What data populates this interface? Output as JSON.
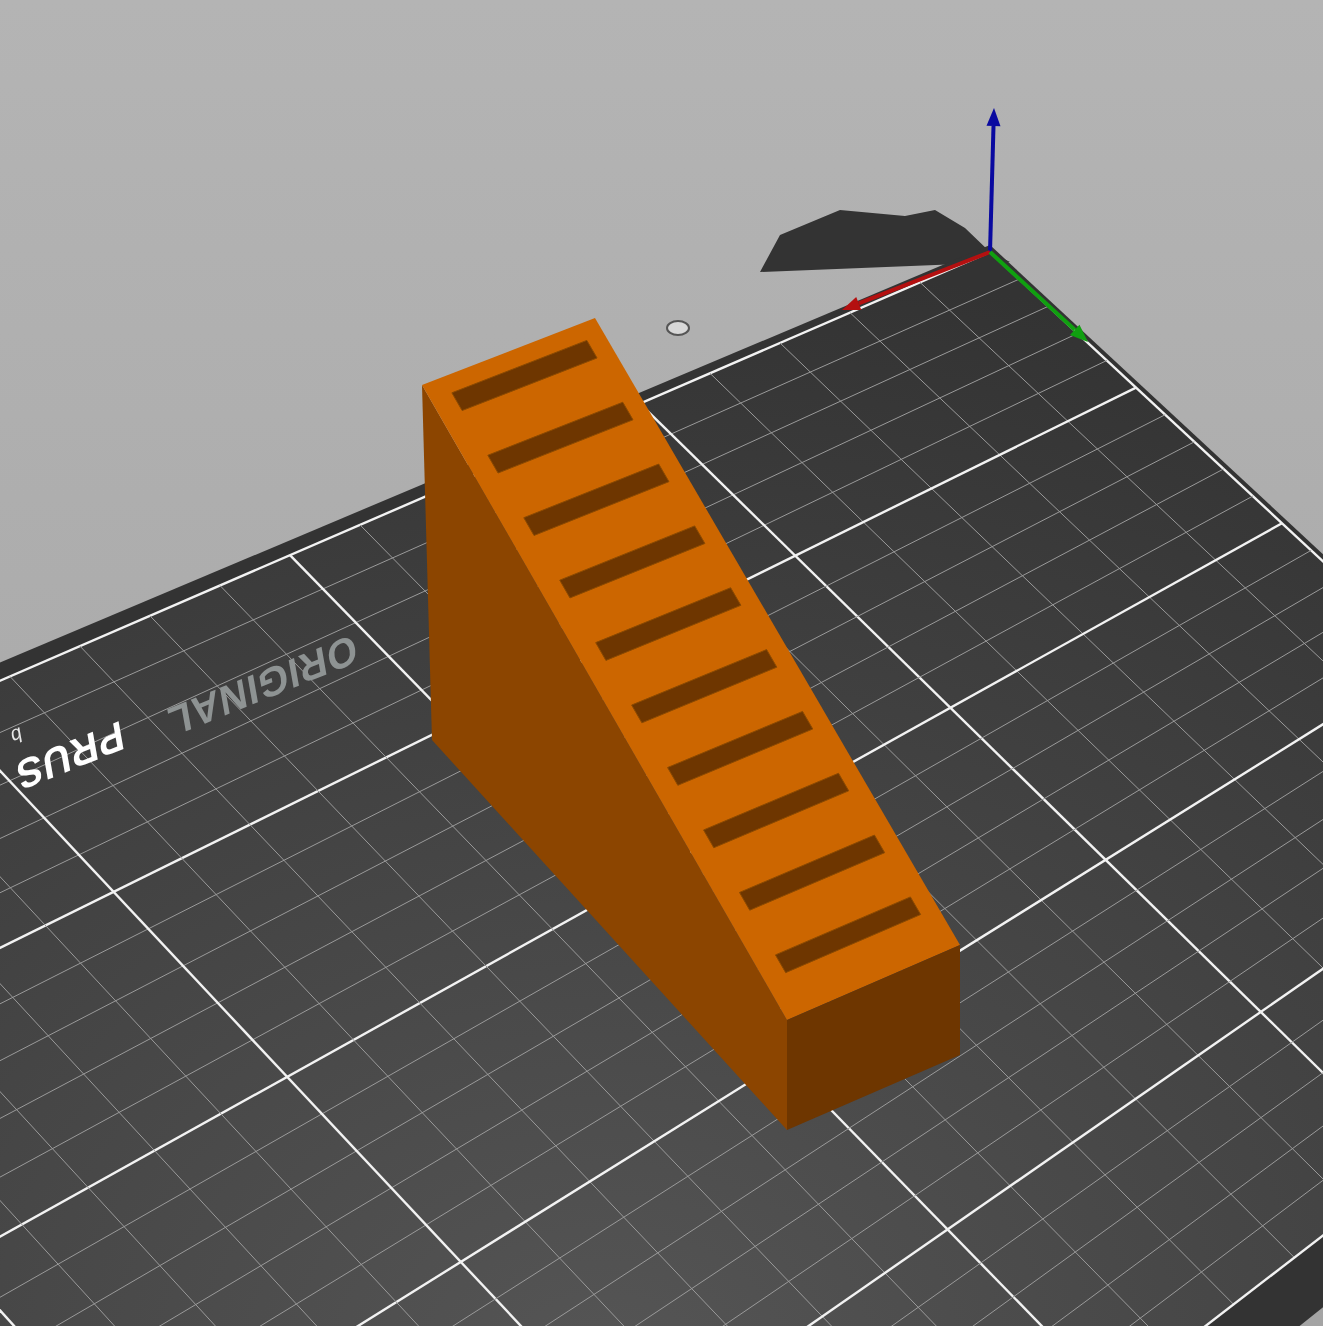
{
  "bed_labels": [
    {
      "kind": "brand",
      "text": "ORIGINAL"
    },
    {
      "kind": "bold",
      "text": "PRUS"
    },
    {
      "kind": "small",
      "text": "b"
    }
  ]
}
